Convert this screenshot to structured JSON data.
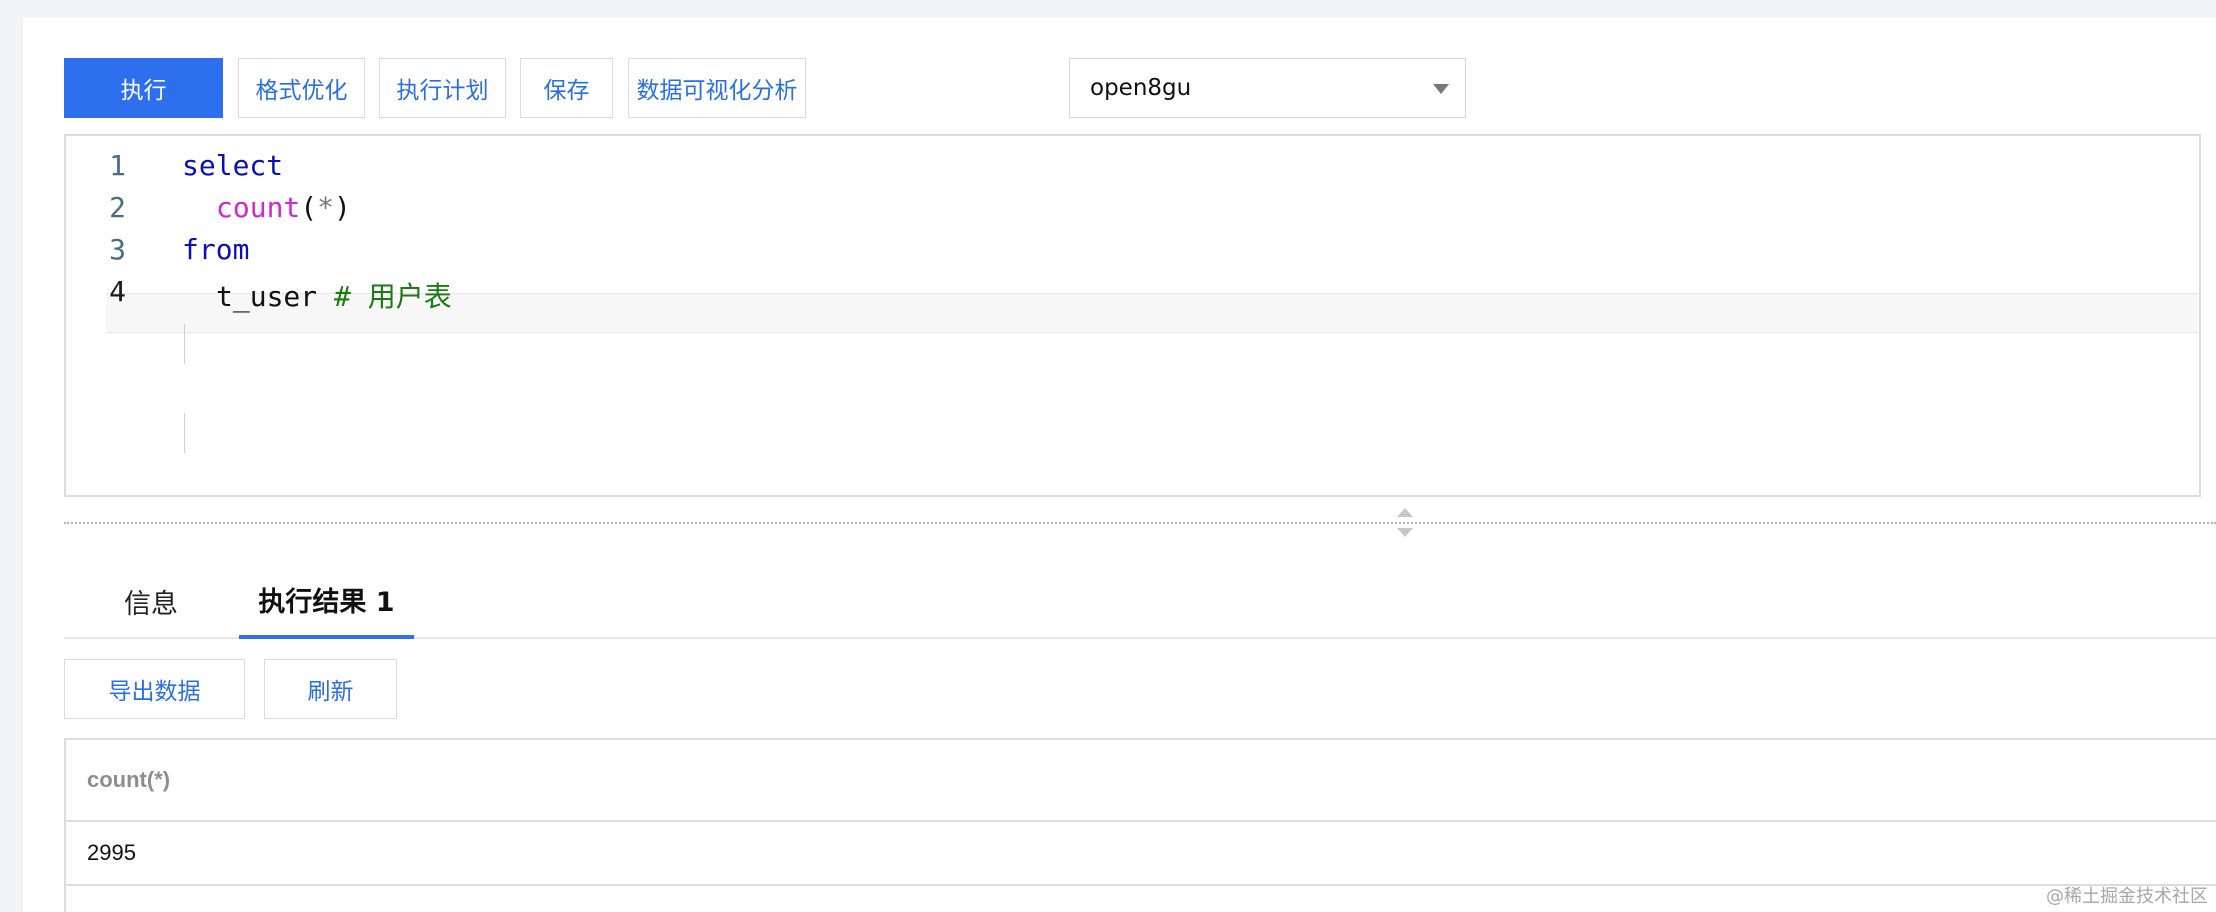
{
  "toolbar": {
    "execute_label": "执行",
    "format_label": "格式优化",
    "plan_label": "执行计划",
    "save_label": "保存",
    "visualize_label": "数据可视化分析",
    "database_value": "open8gu"
  },
  "editor": {
    "lines": [
      {
        "number": "1",
        "keyword": "select"
      },
      {
        "number": "2",
        "func": "count",
        "open": "(",
        "star": "*",
        "close": ")"
      },
      {
        "number": "3",
        "keyword": "from"
      },
      {
        "number": "4",
        "ident": "t_user",
        "comment": "# 用户表"
      }
    ]
  },
  "tabs": [
    {
      "label": "信息"
    },
    {
      "label": "执行结果 1"
    }
  ],
  "results_toolbar": {
    "export_label": "导出数据",
    "refresh_label": "刷新"
  },
  "table": {
    "columns": [
      "count(*)"
    ],
    "rows": [
      [
        "2995"
      ]
    ]
  },
  "watermark": "@稀土掘金技术社区",
  "colors": {
    "primary": "#2e6fee",
    "keyword": "#0a10b5",
    "function": "#d127cf",
    "comment": "#1d7a13"
  }
}
